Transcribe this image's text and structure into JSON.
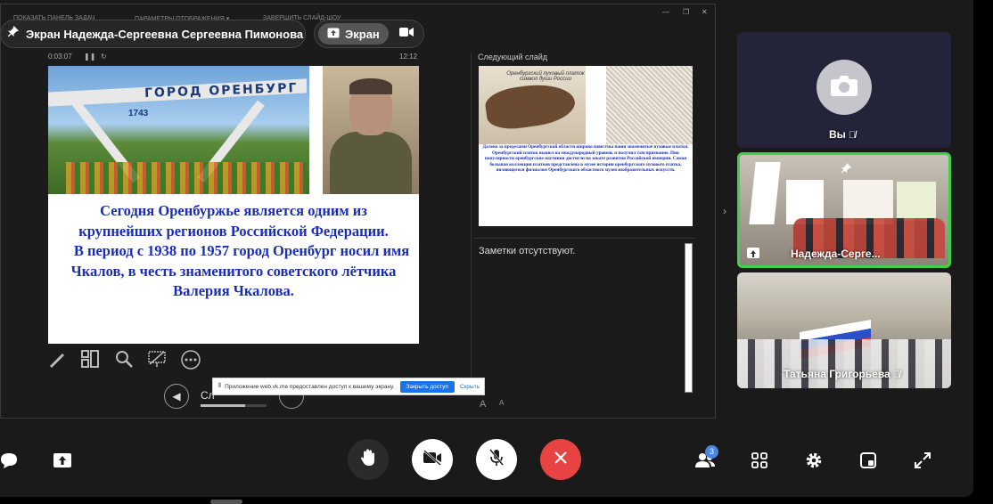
{
  "presenter_toolbar": {
    "show_taskbar": "ПОКАЗАТЬ ПАНЕЛЬ ЗАДАЧ",
    "display_settings": "ПАРАМЕТРЫ ОТОБРАЖЕНИЯ ▾",
    "end_show": "ЗАВЕРШИТЬ СЛАЙД-ШОУ"
  },
  "screen_share": {
    "title": "Экран Надежда-Сергеевна Сергеевна Пимонова",
    "screen_button": "Экран"
  },
  "presenter": {
    "elapsed": "0:03:07",
    "clock": "12:12",
    "slide_sign": "ГОРОД ОРЕНБУРГ",
    "slide_year": "1743",
    "slide_text_1": "Сегодня Оренбуржье является одним из крупнейших регионов Российской Федерации.",
    "slide_text_2": "В период с 1938 по 1957 город Оренбург носил имя Чкалов, в честь знаменитого советского лётчика Валерия Чкалова.",
    "nav_label": "Сл",
    "progress": 0.68,
    "next_slide_label": "Следующий слайд",
    "next_slide_caption": "Оренбургский пуховый платок символ души России",
    "next_slide_text": "Далеко за пределами Оренбургской области широко известны наши знаменитые пуховые платки. Оренбургский платок вышел на международный уровень и получил там признание. Пик популярности оренбургские паутинки достигли на закате развития Российской империи. Самая большая коллекция платков представлена в музее истории оренбургского пухового платка, являющегося филиалом Оренбургского областного музея изобразительных искусств.",
    "notes": "Заметки отсутствуют.",
    "font_increase": "A",
    "font_decrease": "A"
  },
  "notification": {
    "message": "Приложение web.vk.me предоставлен доступ к вашему экрану.",
    "stop_button": "Закрыть доступ",
    "hide_link": "Скрыть"
  },
  "participants": [
    {
      "name": "Вы",
      "muted": true
    },
    {
      "name": "Надежда-Серге...",
      "muted": false,
      "active_speaker": true,
      "sharing_screen": true
    },
    {
      "name": "Татьяна Григорьева",
      "muted": true
    }
  ],
  "participant_count": "3",
  "colors": {
    "active_border": "#3fd14a",
    "end_call": "#e84343",
    "slide_text": "#1a2db8",
    "badge": "#4a86e8"
  }
}
